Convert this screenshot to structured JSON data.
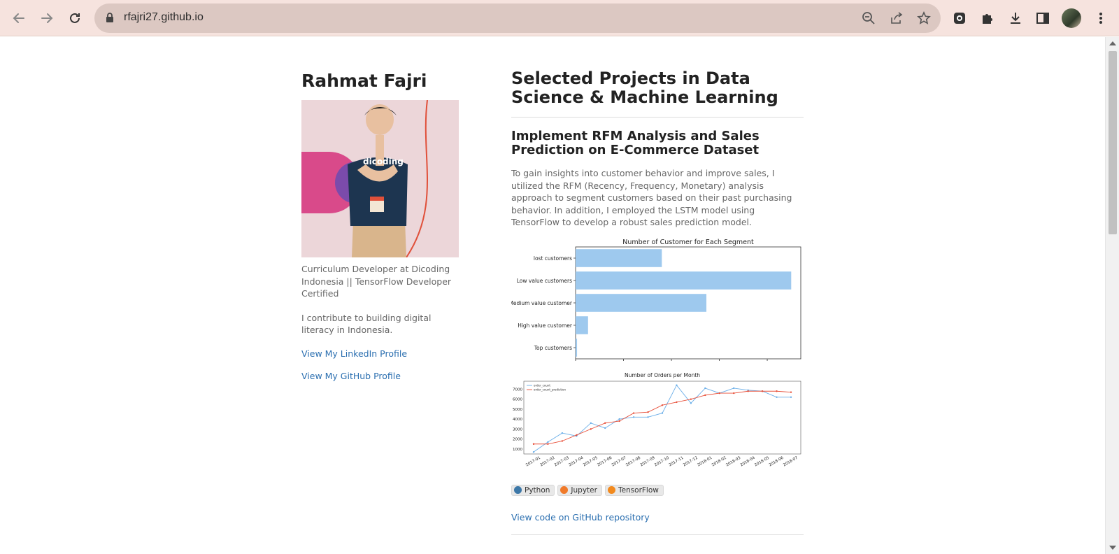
{
  "browser": {
    "url": "rfajri27.github.io"
  },
  "sidebar": {
    "name": "Rahmat Fajri",
    "bio": "Curriculum Developer at Dicoding Indonesia || TensorFlow Developer Certified",
    "bio2": "I contribute to building digital literacy in Indonesia.",
    "linkedin": "View My LinkedIn Profile",
    "github": "View My GitHub Profile"
  },
  "main": {
    "title": "Selected Projects in Data Science & Machine Learning",
    "project": {
      "title": "Implement RFM Analysis and Sales Prediction on E-Commerce Dataset",
      "description": "To gain insights into customer behavior and improve sales, I utilized the RFM (Recency, Frequency, Monetary) analysis approach to segment customers based on their past purchasing behavior. In addition, I employed the LSTM model using TensorFlow to develop a robust sales prediction model.",
      "badges": [
        {
          "label": "Python",
          "color": "#3d78a8"
        },
        {
          "label": "Jupyter",
          "color": "#f07a2a"
        },
        {
          "label": "TensorFlow",
          "color": "#f28a1e"
        }
      ],
      "repo_link": "View code on GitHub repository"
    }
  },
  "chart_data": [
    {
      "type": "bar",
      "title": "Number of Customer for Each Segment",
      "orientation": "horizontal",
      "categories": [
        "lost customers",
        "Low value customers",
        "Medium value customer",
        "High value customer",
        "Top customers"
      ],
      "values": [
        18000,
        45000,
        27300,
        2600,
        300
      ],
      "xticks": [
        "0",
        "10000",
        "20000",
        "30000",
        "40000"
      ],
      "xlim": [
        0,
        47000
      ],
      "color": "#9ec9ee"
    },
    {
      "type": "line",
      "title": "Number of Orders per Month",
      "categories": [
        "2017-01",
        "2017-02",
        "2017-03",
        "2017-04",
        "2017-05",
        "2017-06",
        "2017-07",
        "2017-08",
        "2017-09",
        "2017-10",
        "2017-11",
        "2017-12",
        "2018-01",
        "2018-02",
        "2018-03",
        "2018-04",
        "2018-05",
        "2018-06",
        "2018-07"
      ],
      "ylim": [
        500,
        7800
      ],
      "yticks": [
        "1000",
        "2000",
        "3000",
        "4000",
        "5000",
        "6000",
        "7000"
      ],
      "series": [
        {
          "name": "order_count",
          "color": "#6aaee8",
          "values": [
            700,
            1700,
            2600,
            2300,
            3600,
            3100,
            4000,
            4200,
            4200,
            4600,
            7400,
            5600,
            7100,
            6600,
            7100,
            6900,
            6800,
            6200,
            6200
          ]
        },
        {
          "name": "order_count_prediction",
          "color": "#e8503a",
          "values": [
            1500,
            1500,
            1800,
            2400,
            3000,
            3600,
            3800,
            4600,
            4700,
            5400,
            5700,
            6000,
            6400,
            6600,
            6600,
            6800,
            6800,
            6800,
            6700
          ]
        }
      ]
    }
  ]
}
